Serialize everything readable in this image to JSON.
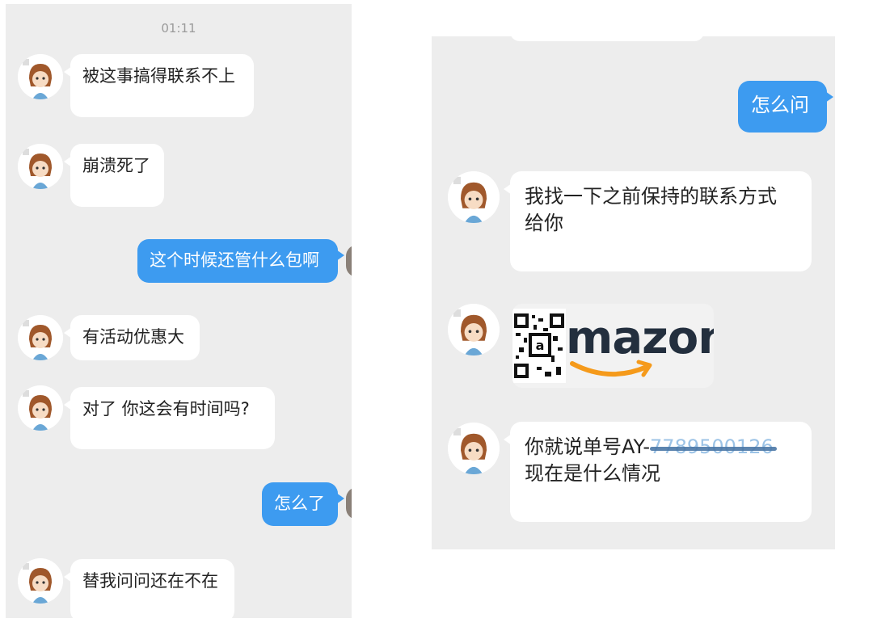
{
  "left_chat": {
    "timestamp": "01:11",
    "messages": [
      {
        "from": "contact",
        "text": "被这事搞得联系不上"
      },
      {
        "from": "contact",
        "text": "崩溃死了"
      },
      {
        "from": "me",
        "text": "这个时候还管什么包啊"
      },
      {
        "from": "contact",
        "text": "有活动优惠大"
      },
      {
        "from": "contact",
        "text": "对了 你这会有时间吗?"
      },
      {
        "from": "me",
        "text": "怎么了"
      },
      {
        "from": "contact",
        "text": "替我问问还在不在"
      }
    ]
  },
  "right_chat": {
    "messages": [
      {
        "from": "me",
        "text": "怎么问"
      },
      {
        "from": "contact",
        "line1": "我找一下之前保持的联系方式",
        "line2": "给你"
      },
      {
        "from": "contact",
        "type": "image",
        "brand_text": "mazon",
        "brand_icon": "qr-code-icon",
        "arrow_color": "#f59a1b"
      },
      {
        "from": "contact",
        "prefix": "你就说单号AY-",
        "order_masked": "7789500126",
        "line2": "现在是什么情况"
      }
    ]
  },
  "colors": {
    "sent_bubble": "#3d9bf0",
    "received_bubble": "#ffffff",
    "background": "#ededed"
  }
}
